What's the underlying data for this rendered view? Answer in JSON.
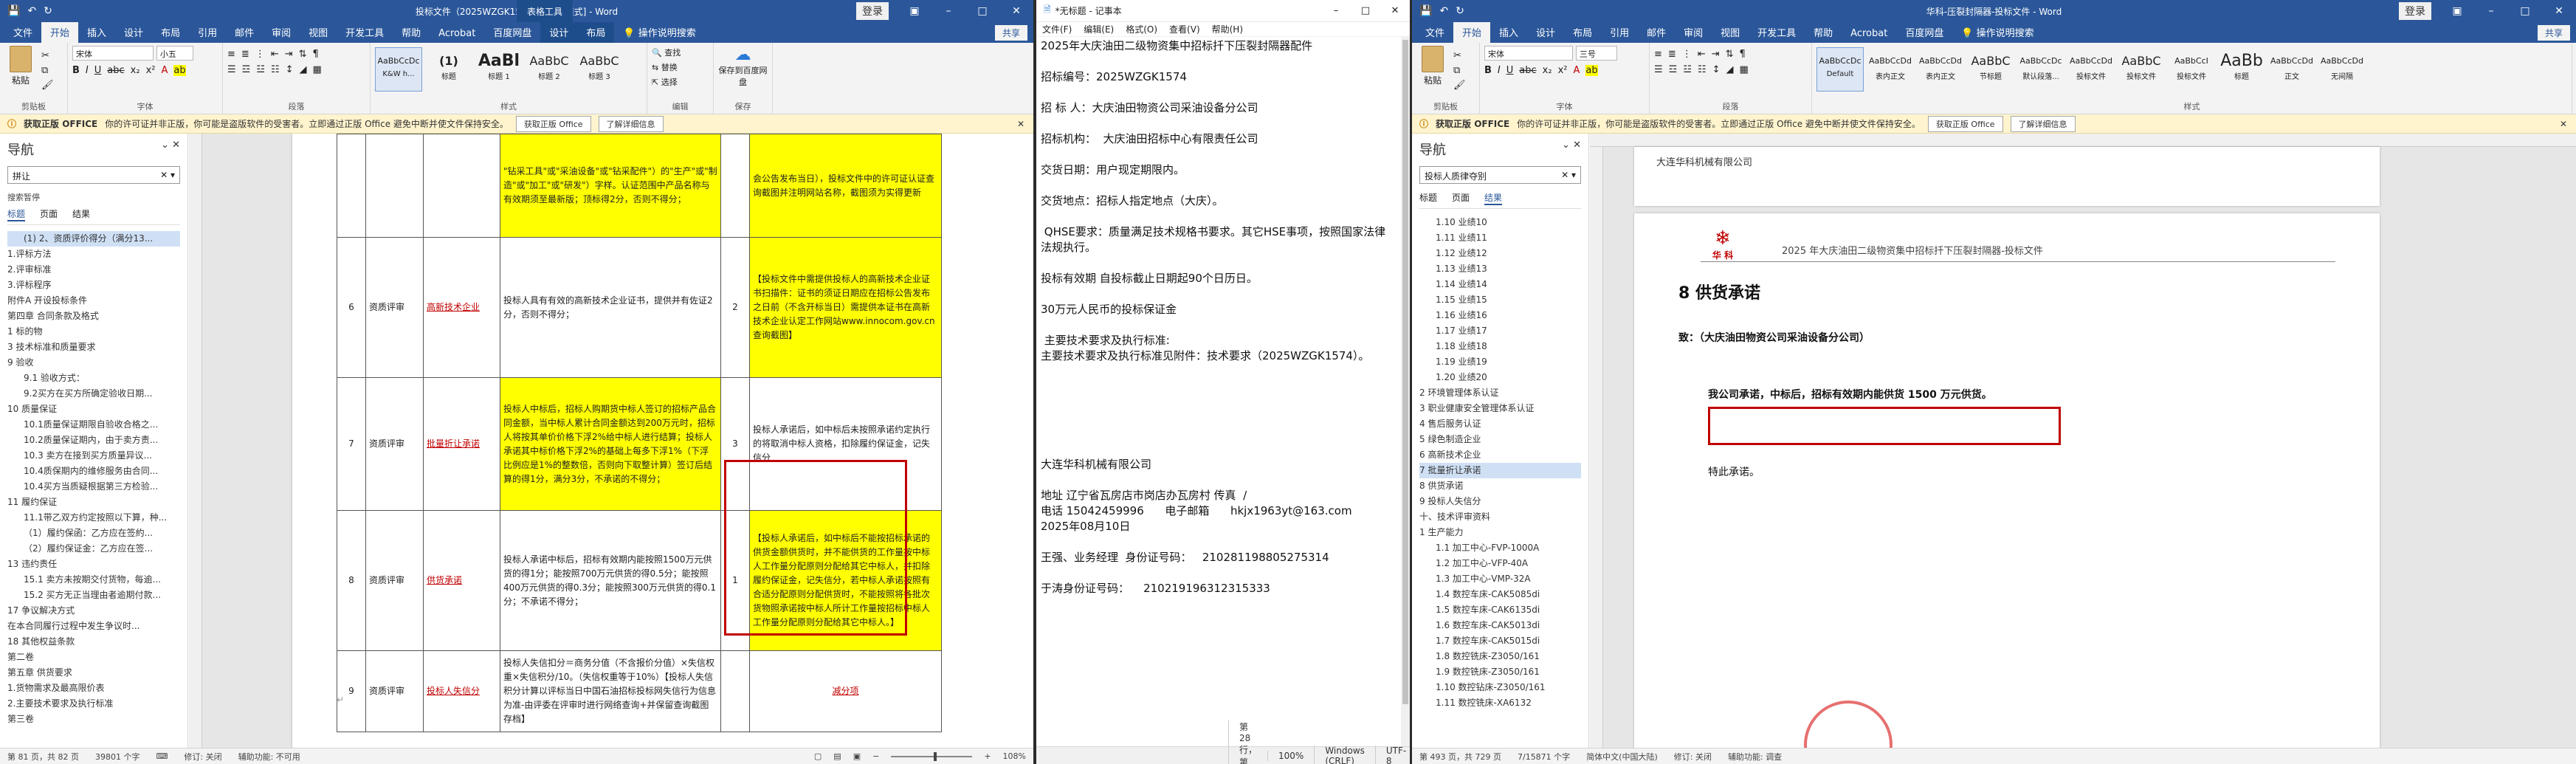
{
  "w1": {
    "title": "投标文件（2025WZGK1574） [兼容模式] - Word",
    "ctx_title": "表格工具",
    "signin": "登录",
    "tabs": [
      "文件",
      "开始",
      "插入",
      "设计",
      "布局",
      "引用",
      "邮件",
      "审阅",
      "视图",
      "开发工具",
      "帮助",
      "Acrobat",
      "百度网盘",
      "设计",
      "布局",
      "操作说明搜索"
    ],
    "share": "共享",
    "font_name": "宋体",
    "font_size": "小五",
    "paste_label": "粘贴",
    "groups": [
      "剪贴板",
      "字体",
      "段落",
      "样式",
      "编辑",
      "保存"
    ],
    "styles": [
      {
        "preview": "AaBbCcDc",
        "name": "K&W h..."
      },
      {
        "preview": "(1)",
        "name": "标题"
      },
      {
        "preview": "AaBl",
        "name": "标题 1"
      },
      {
        "preview": "AaBbC",
        "name": "标题 2"
      },
      {
        "preview": "AaBbC",
        "name": "标题 3"
      }
    ],
    "edit_items": [
      "查找",
      "替换",
      "选择"
    ],
    "save_label": "保存到百度网盘",
    "notice": {
      "label": "获取正版 OFFICE",
      "text": "你的许可证并非正版，你可能是盗版软件的受害者。立即通过正版 Office 避免中断并使文件保持安全。",
      "btn1": "获取正版 Office",
      "btn2": "了解详细信息"
    },
    "nav": {
      "title": "导航",
      "search": "拼让",
      "sub": "搜索暂停",
      "tabs": [
        "标题",
        "页面",
        "结果"
      ],
      "items": [
        "(1) 2、资质评价得分（满分13...",
        "1.评标方法",
        "2.评审标准",
        "3.评标程序",
        "附件A 开设投标条件",
        "第四章 合同条款及格式",
        "1 标的物",
        "3 技术标准和质量要求",
        "9 验收",
        "9.1 验收方式：",
        "9.2买方在买方所确定验收日期...",
        "10 质量保证",
        "10.1质量保证期限自验收合格之...",
        "10.2质量保证期内，由于卖方责...",
        "10.3 卖方在接到买方质量异议...",
        "10.4质保期内的维修服务由合同...",
        "10.4买方当质疑根据第三方检验...",
        "11 履约保证",
        "11.1带乙双方约定按照以下算，种...",
        "（1）履约保函：乙方应在签約...",
        "（2）履约保证金：乙方应在签...",
        "13 违约责任",
        "15.1 卖方未按期交付货物，每逾...",
        "15.2 买方无正当理由者逾期付款...",
        "17 争议解决方式",
        "在本合同履行过程中发生争议时...",
        "18 其他权益条款",
        "第二卷",
        "第五章 供货要求",
        "1.货物需求及最高限价表",
        "2.主要技术要求及执行标准",
        "第三卷"
      ]
    },
    "table": [
      {
        "no": "",
        "type": "",
        "item": "",
        "content": "\"钻采工具\"或\"采油设备\"或\"钻采配件\"）的\"生产\"或\"制造\"或\"加工\"或\"研发\"）字样。认证范围中产品名称与有效期须至最新版；顶标得2分，否则不得分；",
        "score": "",
        "remark": "会公告发布当日），投标文件中的许可证认证查询截图并注明网站名称，截图须为实得更新"
      },
      {
        "no": "6",
        "type": "资质评审",
        "item": "高新技术企业",
        "content": "投标人具有有效的高新技术企业证书，提供并有佐证2分，否则不得分；",
        "score": "2",
        "remark": "【投标文件中需提供投标人的高新技术企业证书扫描件：证书的须证日期应在招标公告发布之日前（不含开标当日）需提供本证书在高新技术企业认定工作网站www.innocom.gov.cn查询截图】"
      },
      {
        "no": "7",
        "type": "资质评审",
        "item": "批量折让承诺",
        "content": "投标人中标后，招标人购期货中标人签订的招标产品合同金额，当中标人累计合同金额达到200万元时，招标人将按其单价价格下浮2%给中标人进行结算；投标人承诺其中标价格下浮2%的基础上每多下浮1%（下浮比例应是1%的整数倍，否则向下取整计算）签订后结算的得1分，满分3分，不承诺的不得分；",
        "score": "3",
        "remark": "投标人承诺后，如中标后未按照承诺约定执行的将取消中标人资格，扣除履约保证金，记失信分"
      },
      {
        "no": "8",
        "type": "资质评审",
        "item": "供货承诺",
        "content": "投标人承诺中标后，招标有效期内能按照1500万元供货的得1分；能按照700万元供货的得0.5分；能按照400万元供货的得0.3分；能按照300万元供货的得0.1分；不承诺不得分；",
        "score": "1",
        "remark": "【投标人承诺后，如中标后不能按招标承诺的供货金额供货时，并不能供货的工作量按中标人工作量分配原则分配给其它中标人，并扣除履约保证金，记失信分，若中标人承诺按照有合适分配原则分配供货时，不能按照将各批次货物照承诺按中标人所计工作量按招标中标人工作量分配原则分配给其它中标人。】"
      },
      {
        "no": "9",
        "type": "资质评审",
        "item": "投标人失信分",
        "content": "投标人失信扣分＝商务分值（不含报价分值）×失信权重×失信积分/10。（失信权重等于10%）【投标人失信积分计算以评标当日中国石油招标投标网失信行为信息为准-由评委在评审时进行网络查询+并保留查询截图存档】",
        "score": "",
        "remark": "减分项"
      }
    ],
    "status": {
      "page": "第 81 页，共 82 页",
      "words": "39801 个字",
      "track": "修订: 关闭",
      "access": "辅助功能: 不可用",
      "zoom": "108%"
    }
  },
  "w2": {
    "title": "*无标题 - 记事本",
    "menu": [
      "文件(F)",
      "编辑(E)",
      "格式(O)",
      "查看(V)",
      "帮助(H)"
    ],
    "lines": [
      "2025年大庆油田二级物资集中招标扦下压裂封隔器配件",
      "",
      "招标编号：2025WZGK1574",
      "",
      "招 标 人：大庆油田物资公司采油设备分公司",
      "",
      "招标机构：  大庆油田招标中心有限责任公司",
      "",
      "交货日期：用户现定期限内。",
      "",
      "交货地点：招标人指定地点（大庆）。",
      "",
      " QHSE要求：质量满足技术规格书要求。其它HSE事项，按照国家法律法规执行。",
      "",
      "投标有效期 自投标截止日期起90个日历日。",
      "",
      "30万元人民币的投标保证金",
      "",
      " 主要技术要求及执行标准:",
      "主要技术要求及执行标准见附件：技术要求（2025WZGK1574）。",
      "",
      "",
      "",
      "",
      "",
      "",
      "大连华科机械有限公司",
      "",
      "地址 辽宁省瓦房店市岗店办瓦房村 传真  /",
      "电话 15042459996      电子邮箱      hkjx1963yt@163.com",
      "2025年08月10日",
      "",
      "王强、业务经理  身份证号码：   210281198805275314",
      "",
      "于涛身份证号码：    210219196312315333"
    ],
    "status": {
      "pos": "第 28 行，第 25 列",
      "zoom": "100%",
      "eol": "Windows (CRLF)",
      "enc": "UTF-8"
    }
  },
  "w3": {
    "title": "华科-压裂封隔器-投标文件 - Word",
    "signin": "登录",
    "tabs": [
      "文件",
      "开始",
      "插入",
      "设计",
      "布局",
      "引用",
      "邮件",
      "审阅",
      "视图",
      "开发工具",
      "帮助",
      "Acrobat",
      "百度网盘",
      "操作说明搜索"
    ],
    "share": "共享",
    "font_name": "宋体",
    "font_size": "三号",
    "paste_label": "粘贴",
    "groups": [
      "剪贴板",
      "字体",
      "段落",
      "样式"
    ],
    "styles": [
      {
        "preview": "AaBbCcDc",
        "name": "Default"
      },
      {
        "preview": "AaBbCcDd",
        "name": "表内正文"
      },
      {
        "preview": "AaBbCcDd",
        "name": "表内正文"
      },
      {
        "preview": "AaBbC",
        "name": "节标题"
      },
      {
        "preview": "AaBbCcDc",
        "name": "默认段落..."
      },
      {
        "preview": "AaBbCcDd",
        "name": "投标文件"
      },
      {
        "preview": "AaBbC",
        "name": "投标文件"
      },
      {
        "preview": "AaBbCcI",
        "name": "投标文件"
      },
      {
        "preview": "AaBb",
        "name": "标题"
      },
      {
        "preview": "AaBbCcDd",
        "name": "正文"
      },
      {
        "preview": "AaBbCcDd",
        "name": "无间隔"
      }
    ],
    "notice": {
      "label": "获取正版 OFFICE",
      "text": "你的许可证并非正版，你可能是盗版软件的受害者。立即通过正版 Office 避免中断并使文件保持安全。",
      "btn1": "获取正版 Office",
      "btn2": "了解详细信息"
    },
    "nav": {
      "title": "导航",
      "search": "投标人质律夺别",
      "sub": "",
      "tabs": [
        "标题",
        "页面",
        "结果"
      ],
      "items": [
        "1.10 业绩10",
        "1.11 业绩11",
        "1.12 业绩12",
        "1.13 业绩13",
        "1.14 业绩14",
        "1.15 业绩15",
        "1.16 业绩16",
        "1.17 业绩17",
        "1.18 业绩18",
        "1.19 业绩19",
        "1.20 业绩20",
        "2 环境管理体系认证",
        "3 职业健康安全管理体系认证",
        "4 售后服务认证",
        "5 绿色制造企业",
        "6 高新技术企业",
        "7 批量折让承诺",
        "8 供货承诺",
        "9 投标人失信分",
        "十、技术评审资料",
        "1 生产能力",
        "1.1 加工中心-FVP-1000A",
        "1.2 加工中心-VFP-40A",
        "1.3 加工中心-VMP-32A",
        "1.4 数控车床-CAK5085di",
        "1.5 数控车床-CAK6135di",
        "1.6 数控车床-CAK5013di",
        "1.7 数控车床-CAK5015di",
        "1.8 数控铣床-Z3050/161",
        "1.9 数控铣床-Z3050/161",
        "1.10 数控钻床-Z3050/161",
        "1.11 数控铣床-XA6132"
      ]
    },
    "doc": {
      "top_company": "大连华科机械有限公司",
      "logo_text": "华 科",
      "header": "2025 年大庆油田二级物资集中招标扦下压裂封隔器-投标文件",
      "heading": "8  供货承诺",
      "to": "致：（大庆油田物资公司采油设备分公司）",
      "body": "我公司承诺，中标后，招标有效期内能供货 1500 万元供货。",
      "closing": "特此承诺。"
    },
    "status": {
      "page": "第 493 页，共 729 页",
      "words": "7/15871 个字",
      "lang": "简体中文(中国大陆)",
      "track": "修订: 关闭",
      "access": "辅助功能: 调查"
    }
  }
}
